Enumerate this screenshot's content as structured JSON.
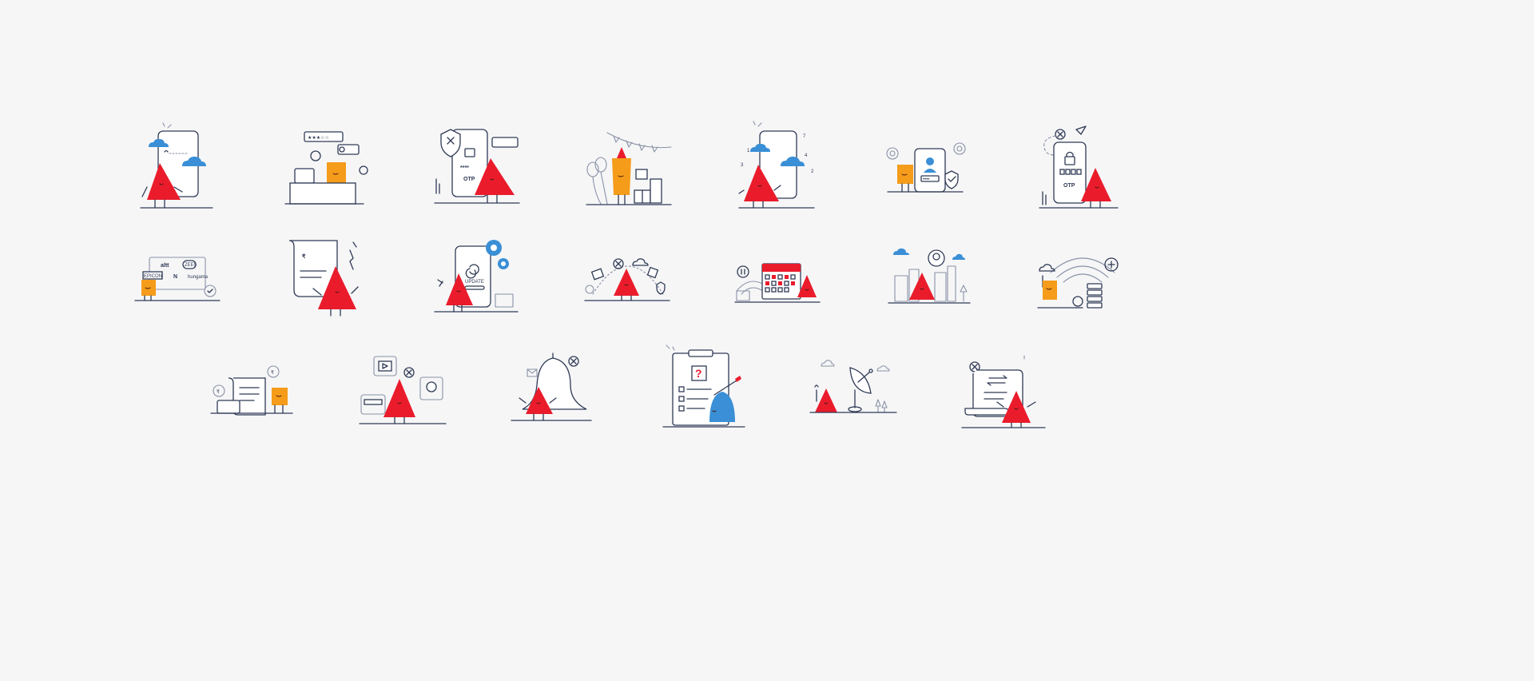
{
  "labels": {
    "otp_1": "OTP",
    "otp_2": "OTP",
    "update": "UPDATE",
    "alt_text": "altt",
    "zee_text": "ZEE5",
    "epic_on": "EPICON",
    "hungama": "hungama",
    "rupee": "₹",
    "question": "?",
    "num_1": "1",
    "num_2": "2",
    "num_3": "3",
    "num_4": "4",
    "num_7": "7",
    "password_dots": "****"
  },
  "colors": {
    "background": "#f6f6f7",
    "line": "#2f3a55",
    "brand_red": "#ea1c2c",
    "brand_orange": "#f59c1a",
    "brand_blue": "#3a8fd6"
  },
  "illustrations": [
    {
      "name": "phone-call-clouds",
      "icon": "phone-icon",
      "mascot": "red"
    },
    {
      "name": "customer-support-desk",
      "icon": "laptop-icon",
      "mascot": "orange"
    },
    {
      "name": "otp-security-phone",
      "icon": "shield-icon",
      "mascot": "red"
    },
    {
      "name": "celebration-party",
      "icon": "gift-icon",
      "mascot": "orange"
    },
    {
      "name": "phone-countdown-clouds",
      "icon": "phone-icon",
      "mascot": "red"
    },
    {
      "name": "user-profile-verify",
      "icon": "user-icon",
      "mascot": "orange"
    },
    {
      "name": "otp-lock-phone",
      "icon": "lock-icon",
      "mascot": "red"
    },
    {
      "name": "streaming-apps",
      "icon": "tv-icon",
      "mascot": "orange"
    },
    {
      "name": "bill-receipt-error",
      "icon": "receipt-icon",
      "mascot": "red"
    },
    {
      "name": "app-update-phone",
      "icon": "gear-icon",
      "mascot": "red"
    },
    {
      "name": "network-services-arc",
      "icon": "cloud-icon",
      "mascot": "red"
    },
    {
      "name": "wifi-calendar-schedule",
      "icon": "calendar-icon",
      "mascot": "red"
    },
    {
      "name": "city-location",
      "icon": "location-pin-icon",
      "mascot": "red"
    },
    {
      "name": "wifi-cloud-server",
      "icon": "server-icon",
      "mascot": "orange"
    },
    {
      "name": "payment-bill",
      "icon": "card-icon",
      "mascot": "orange"
    },
    {
      "name": "connected-devices-error",
      "icon": "router-icon",
      "mascot": "red"
    },
    {
      "name": "notification-bell-error",
      "icon": "bell-icon",
      "mascot": "red"
    },
    {
      "name": "clipboard-question",
      "icon": "clipboard-icon",
      "mascot": "blue"
    },
    {
      "name": "satellite-dish",
      "icon": "satellite-icon",
      "mascot": "red"
    },
    {
      "name": "transaction-scroll-error",
      "icon": "transfer-icon",
      "mascot": "red"
    }
  ]
}
